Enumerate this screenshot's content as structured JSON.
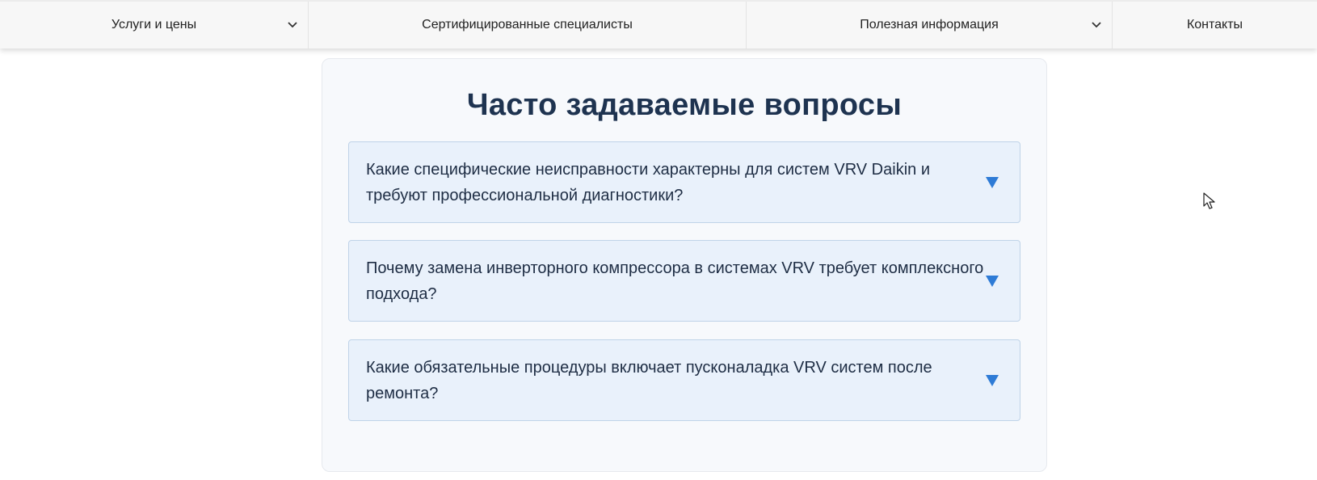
{
  "nav": {
    "items": [
      {
        "label": "Услуги и цены",
        "has_dropdown": true
      },
      {
        "label": "Сертифицированные специалисты",
        "has_dropdown": false
      },
      {
        "label": "Полезная информация",
        "has_dropdown": true
      },
      {
        "label": "Контакты",
        "has_dropdown": false
      }
    ],
    "dropdown_icon": "chevron-down-icon"
  },
  "faq": {
    "title": "Часто задаваемые вопросы",
    "items": [
      {
        "question": "Какие специфические неисправности характерны для систем VRV Daikin и требуют профессиональной диагностики?",
        "expanded": false
      },
      {
        "question": "Почему замена инверторного компрессора в системах VRV требует комплексного подхода?",
        "expanded": false
      },
      {
        "question": "Какие обязательные процедуры включает пусконаладка VRV систем после ремонта?",
        "expanded": false
      }
    ],
    "toggle_icon": "triangle-down-icon"
  },
  "colors": {
    "title": "#1e3350",
    "accent": "#2e7bd6",
    "item_bg": "#e9f1fb",
    "item_border": "#bfd3e8",
    "card_bg": "#f7f9fc"
  }
}
